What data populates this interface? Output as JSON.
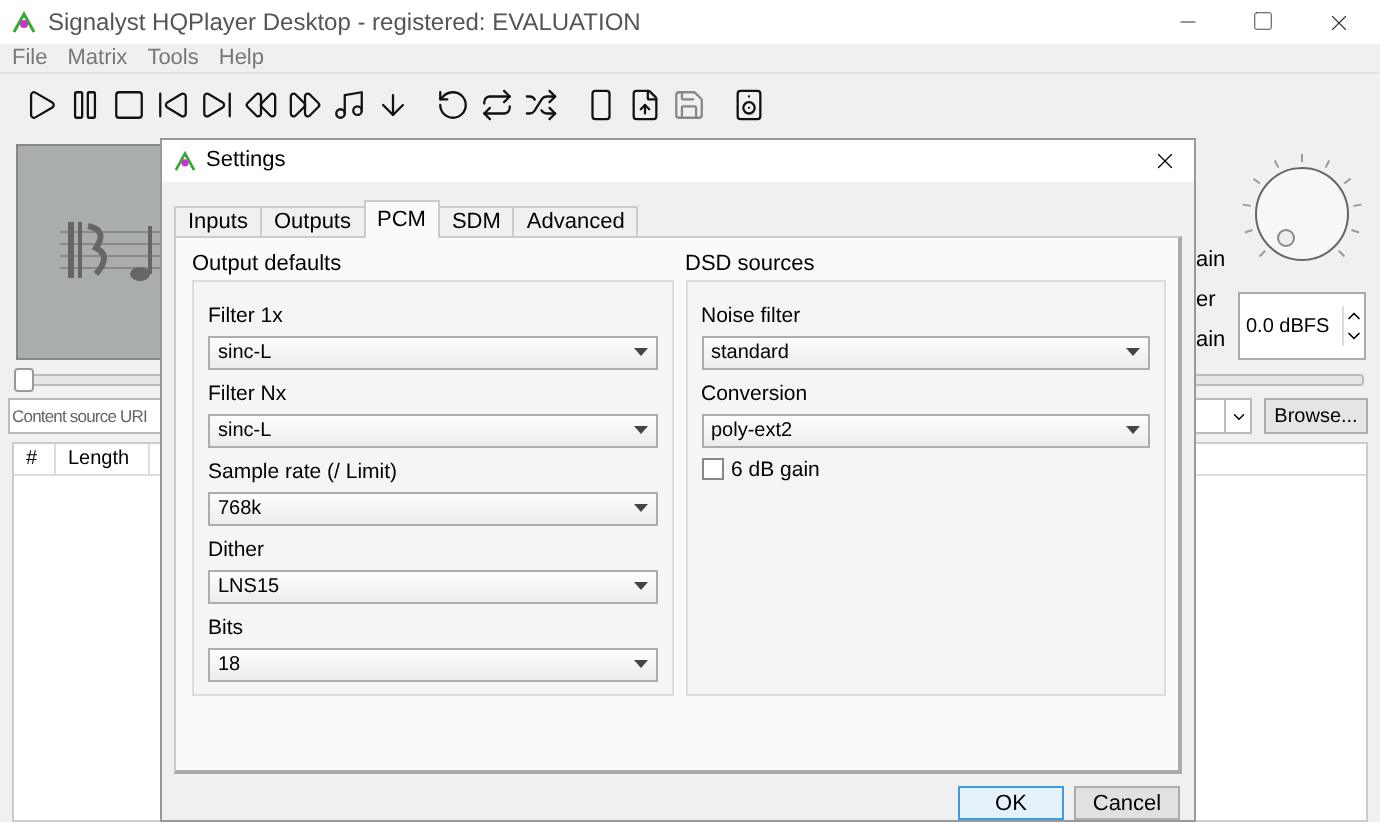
{
  "window": {
    "title": "Signalyst HQPlayer Desktop - registered: EVALUATION"
  },
  "menu": [
    "File",
    "Matrix",
    "Tools",
    "Help"
  ],
  "side_labels": [
    "ain",
    "er",
    "ain"
  ],
  "volume": {
    "value": "0.0 dBFS"
  },
  "seek": {
    "level": 0
  },
  "source": {
    "placeholder": "Content source URI",
    "browse": "Browse..."
  },
  "table": {
    "columns": [
      "#",
      "Length"
    ]
  },
  "dialog": {
    "title": "Settings",
    "tabs": [
      {
        "label": "Inputs",
        "selected": false
      },
      {
        "label": "Outputs",
        "selected": false
      },
      {
        "label": "PCM",
        "selected": true
      },
      {
        "label": "SDM",
        "selected": false
      },
      {
        "label": "Advanced",
        "selected": false
      }
    ],
    "groups": [
      {
        "title": "Output defaults",
        "fields": [
          {
            "kind": "select",
            "label": "Filter 1x",
            "value": "sinc-L"
          },
          {
            "kind": "select",
            "label": "Filter Nx",
            "value": "sinc-L"
          },
          {
            "kind": "select",
            "label": "Sample rate (/ Limit)",
            "value": "768k"
          },
          {
            "kind": "select",
            "label": "Dither",
            "value": "LNS15"
          },
          {
            "kind": "select",
            "label": "Bits",
            "value": "18"
          }
        ]
      },
      {
        "title": "DSD sources",
        "fields": [
          {
            "kind": "select",
            "label": "Noise filter",
            "value": "standard"
          },
          {
            "kind": "select",
            "label": "Conversion",
            "value": "poly-ext2"
          },
          {
            "kind": "checkbox",
            "label": "6 dB gain",
            "checked": false
          }
        ]
      }
    ],
    "buttons": [
      {
        "label": "OK",
        "default": true
      },
      {
        "label": "Cancel",
        "default": false
      }
    ]
  }
}
